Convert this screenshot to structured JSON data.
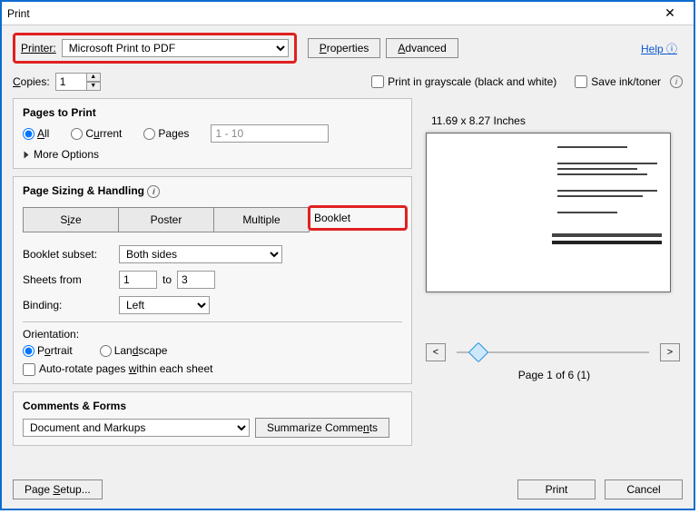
{
  "window": {
    "title": "Print"
  },
  "header": {
    "printer_label": "Printer:",
    "printer_value": "Microsoft Print to PDF",
    "properties_btn": "Properties",
    "advanced_btn": "Advanced",
    "help_link": "Help"
  },
  "copies": {
    "label": "Copies:",
    "value": "1"
  },
  "options": {
    "grayscale": "Print in grayscale (black and white)",
    "save_ink": "Save ink/toner"
  },
  "pages_to_print": {
    "title": "Pages to Print",
    "all": "All",
    "current": "Current",
    "pages": "Pages",
    "range": "1 - 10",
    "more": "More Options"
  },
  "sizing": {
    "title": "Page Sizing & Handling",
    "size": "Size",
    "poster": "Poster",
    "multiple": "Multiple",
    "booklet": "Booklet",
    "subset_label": "Booklet subset:",
    "subset_value": "Both sides",
    "sheets_from": "Sheets from",
    "sheets_to": "to",
    "from_val": "1",
    "to_val": "3",
    "binding_label": "Binding:",
    "binding_value": "Left"
  },
  "orientation": {
    "title": "Orientation:",
    "portrait": "Portrait",
    "landscape": "Landscape",
    "autorotate": "Auto-rotate pages within each sheet"
  },
  "comments": {
    "title": "Comments & Forms",
    "value": "Document and Markups",
    "summarize": "Summarize Comments"
  },
  "preview": {
    "dimensions": "11.69 x 8.27 Inches",
    "page_indicator": "Page 1 of 6 (1)"
  },
  "footer": {
    "page_setup": "Page Setup...",
    "print": "Print",
    "cancel": "Cancel"
  }
}
